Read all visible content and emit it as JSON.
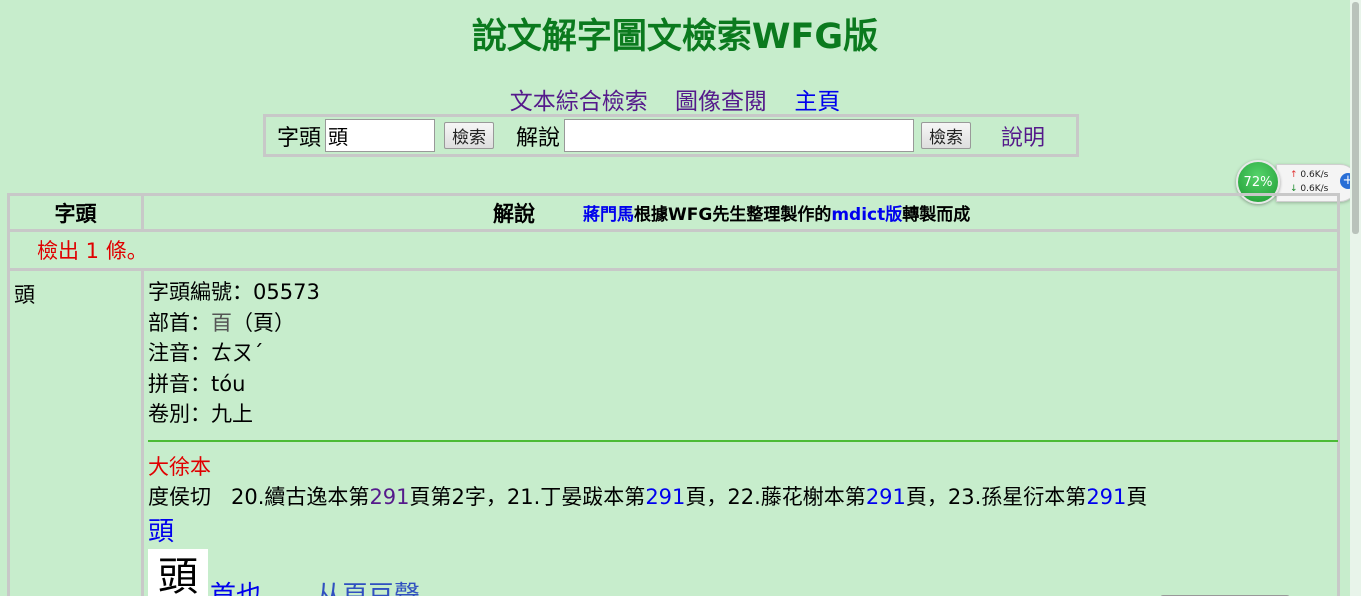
{
  "title": "說文解字圖文檢索WFG版",
  "nav": {
    "text_search": "文本綜合檢索",
    "image_browse": "圖像查閱",
    "home": "主頁"
  },
  "search": {
    "head_label": "字頭",
    "head_value": "頭",
    "search_button": "檢索",
    "expl_label": "解說",
    "expl_value": "",
    "search_button2": "檢索",
    "help": "說明"
  },
  "widget": {
    "percent": "72%",
    "up": "0.6K/s",
    "down": "0.6K/s",
    "up_icon": "arrow-up",
    "down_icon": "arrow-down",
    "add_icon": "plus"
  },
  "table": {
    "col_head": "字頭",
    "col_expl": "解說",
    "credit_author": "蔣門馬",
    "credit_mid": "根據WFG先生整理製作的",
    "credit_link": "mdict版",
    "credit_end": "轉製而成",
    "count": "檢出 1 條。"
  },
  "entry": {
    "char": "頭",
    "code_label": "字頭編號：",
    "code": "05573",
    "radical_label": "部首：",
    "radical": "𦣻",
    "radical_paren": "（頁）",
    "zhuyin_label": "注音：",
    "zhuyin": "ㄊㄡˊ",
    "pinyin_label": "拼音：",
    "pinyin": "tóu",
    "volume_label": "卷別：",
    "volume": "九上",
    "edition": "大徐本",
    "fanqie": "度侯切",
    "ref1_pre": "20.續古逸本第",
    "ref1_page": "291",
    "ref1_post": "頁第2字，",
    "ref2_pre": "21.丁晏跋本第",
    "ref2_page": "291",
    "ref2_post": "頁，",
    "ref3_pre": "22.藤花榭本第",
    "ref3_page": "291",
    "ref3_post": "頁，",
    "ref4_pre": "23.孫星衍本第",
    "ref4_page": "291",
    "ref4_post": "頁",
    "head_char": "頭",
    "glyph": "頭",
    "gloss1": "首也。",
    "gloss2": "从頁豆聲。"
  }
}
